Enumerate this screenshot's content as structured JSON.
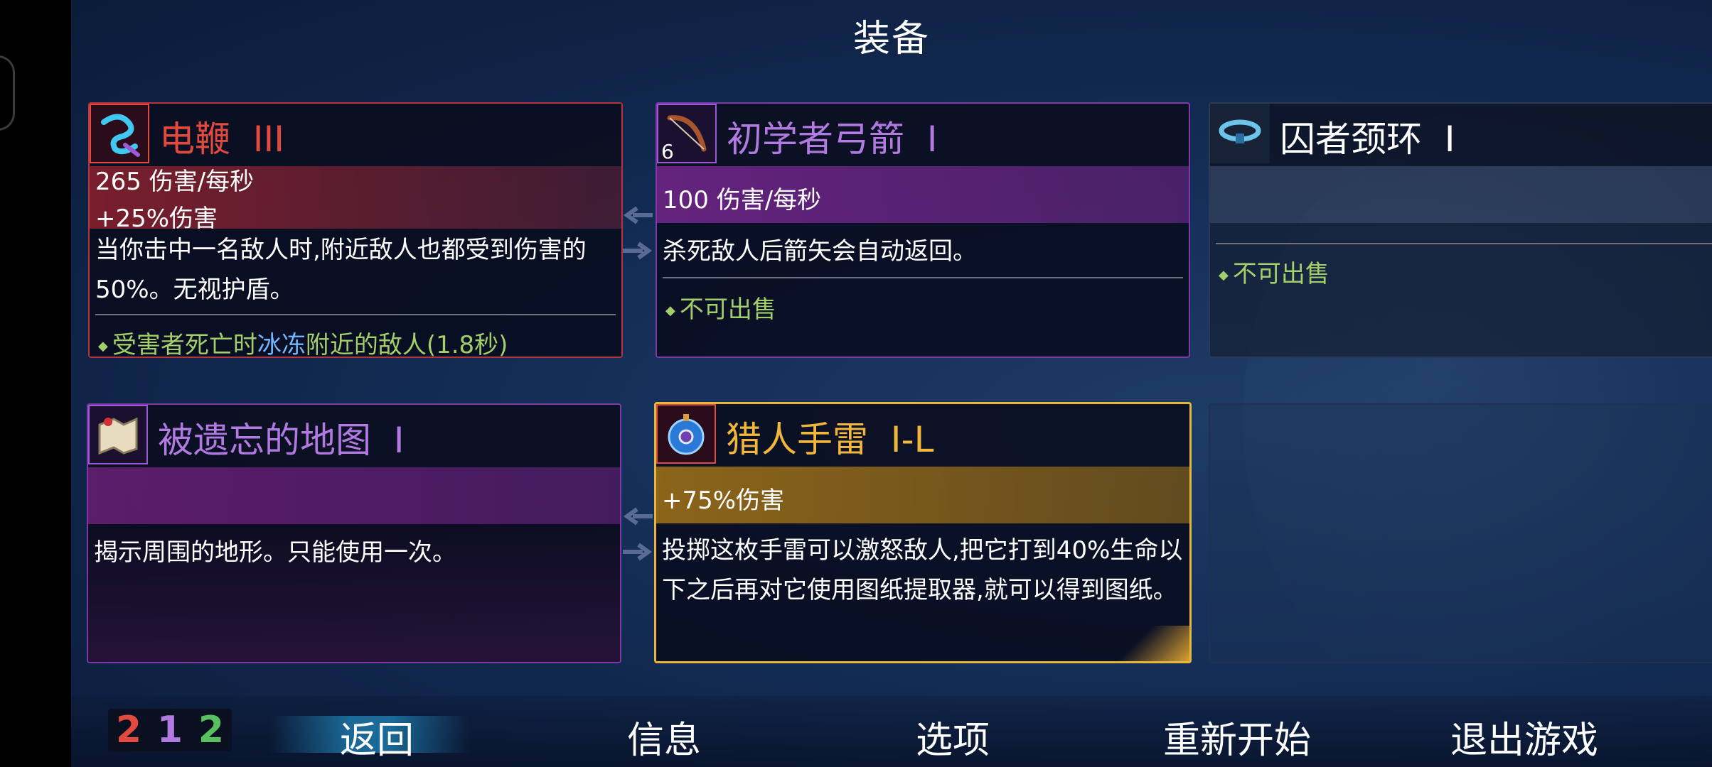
{
  "screen_title": "装备",
  "colors": {
    "red": "#e24a40",
    "purple": "#b07ae0",
    "gold": "#f0b73c",
    "green": "#a2cf69",
    "blue": "#6fb8ff"
  },
  "items": [
    {
      "name": "电鞭",
      "tier": "III",
      "icon": "electric-whip-icon",
      "stats": [
        "265 伤害/每秒",
        "+25%伤害"
      ],
      "description": "当你击中一名敌人时,附近敌人也都受到伤害的50%。无视护盾。",
      "note_prefix": "受害者死亡时",
      "note_highlight": "冰冻",
      "note_suffix": "附近的敌人(1.8秒)"
    },
    {
      "name": "初学者弓箭",
      "tier": "I",
      "icon": "bow-icon",
      "icon_badge": "6",
      "stats": [
        "100 伤害/每秒"
      ],
      "description": "杀死敌人后箭矢会自动返回。",
      "note": "不可出售"
    },
    {
      "name": "囚者颈环",
      "tier": "I",
      "icon": "collar-icon",
      "note": "不可出售"
    },
    {
      "name": "被遗忘的地图",
      "tier": "I",
      "icon": "map-scroll-icon",
      "description": "揭示周围的地形。只能使用一次。"
    },
    {
      "name": "猎人手雷",
      "tier": "I-L",
      "icon": "grenade-icon",
      "stats": [
        "+75%伤害"
      ],
      "description": "投掷这枚手雷可以激怒敌人,把它打到40%生命以下之后再对它使用图纸提取器,就可以得到图纸。"
    }
  ],
  "scroll_counts": {
    "red": "2",
    "purple": "1",
    "green": "2"
  },
  "menu": {
    "back": "返回",
    "info": "信息",
    "options": "选项",
    "restart": "重新开始",
    "quit": "退出游戏"
  }
}
